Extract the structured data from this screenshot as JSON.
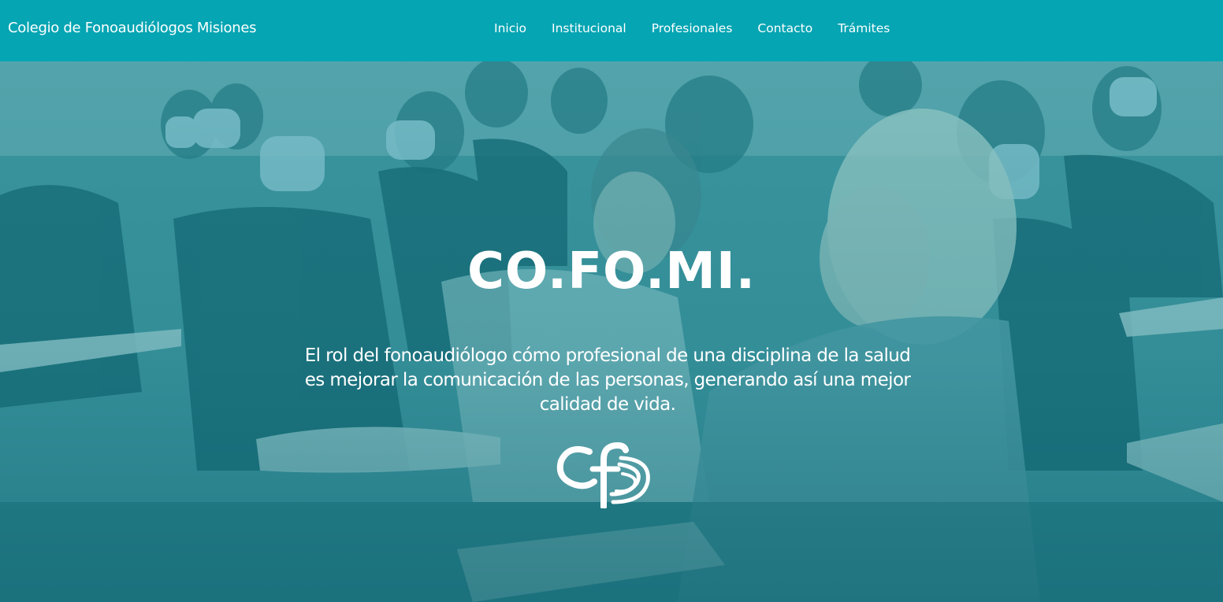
{
  "header": {
    "brand": "Colegio de Fonoaudiólogos Misiones",
    "nav": [
      {
        "label": "Inicio"
      },
      {
        "label": "Institucional"
      },
      {
        "label": "Profesionales"
      },
      {
        "label": "Contacto"
      },
      {
        "label": "Trámites"
      }
    ]
  },
  "hero": {
    "title": "CO.FO.MI.",
    "description": "El rol del fonoaudiólogo cómo profesional de una disciplina de la salud es mejorar la comunicación de las personas, generando así una mejor calidad de vida.",
    "logo_icon": "cf-logo-icon"
  },
  "colors": {
    "nav_background": "#05a5b3",
    "hero_tint": "#1f8f9b",
    "text": "#ffffff"
  }
}
